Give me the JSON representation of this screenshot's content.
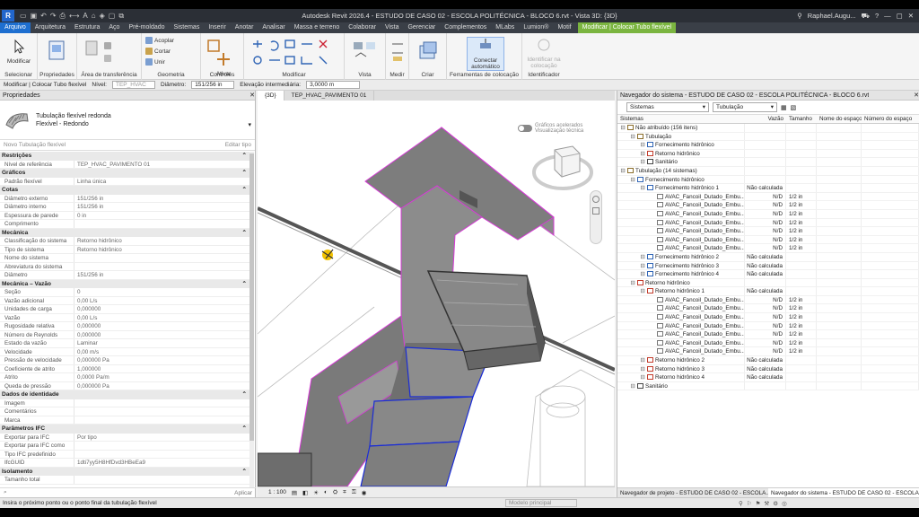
{
  "app": {
    "title": "Autodesk Revit 2026.4 - ESTUDO DE CASO 02 - ESCOLA POLITÉCNICA - BLOCO 6.rvt - Vista 3D: {3D}",
    "user": "Raphael.Augu..."
  },
  "menu": {
    "items": [
      "Arquivo",
      "Arquitetura",
      "Estrutura",
      "Aço",
      "Pré-moldado",
      "Sistemas",
      "Inserir",
      "Anotar",
      "Analisar",
      "Massa e terreno",
      "Colaborar",
      "Vista",
      "Gerenciar",
      "Complementos",
      "MLabs",
      "Lumion®",
      "Motif"
    ],
    "contextual": "Modificar | Colocar Tubo flexível"
  },
  "ribbon": {
    "modify": "Modificar",
    "cut": "Cortar",
    "accept": "Acoplar",
    "join": "Unir",
    "activate": "Ativar",
    "connect": "Conectar automático",
    "identify": "Identificar na colocação",
    "groups": {
      "select": "Selecionar",
      "properties": "Propriedades",
      "clipboard": "Área de transferência",
      "geometry": "Geometria",
      "controls": "Controles",
      "modify": "Modificar",
      "view": "Vista",
      "measure": "Medir",
      "create": "Criar",
      "tools": "Ferramentas de colocação",
      "identifier": "Identificador"
    }
  },
  "options": {
    "context": "Modificar | Colocar Tubo flexível",
    "level_label": "Nível:",
    "level": "TEP_HVAC",
    "diameter_label": "Diâmetro:",
    "diameter": "151/256 in",
    "elev_label": "Elevação intermediária:",
    "elev": "3,0000 m"
  },
  "properties": {
    "header": "Propriedades",
    "type_name": "Tubulação flexível redonda",
    "type_sub": "Flexível - Redondo",
    "new_type": "Novo Tubulação flexível",
    "edit_type": "Editar tipo",
    "apply": "Aplicar",
    "rows": [
      {
        "s": "Restrições"
      },
      {
        "k": "Nível de referência",
        "v": "TEP_HVAC_PAVIMENTO 01"
      },
      {
        "s": "Gráficos"
      },
      {
        "k": "Padrão flexível",
        "v": "Linha única"
      },
      {
        "s": "Cotas"
      },
      {
        "k": "Diâmetro externo",
        "v": "151/256 in"
      },
      {
        "k": "Diâmetro interno",
        "v": "151/256 in"
      },
      {
        "k": "Espessura de parede",
        "v": "0 in"
      },
      {
        "k": "Comprimento",
        "v": ""
      },
      {
        "s": "Mecânica"
      },
      {
        "k": "Classificação do sistema",
        "v": "Retorno hidrônico"
      },
      {
        "k": "Tipo de sistema",
        "v": "Retorno hidrônico"
      },
      {
        "k": "Nome do sistema",
        "v": ""
      },
      {
        "k": "Abreviatura do sistema",
        "v": ""
      },
      {
        "k": "Diâmetro",
        "v": "151/256 in"
      },
      {
        "s": "Mecânica – Vazão"
      },
      {
        "k": "Seção",
        "v": "0"
      },
      {
        "k": "Vazão adicional",
        "v": "0,00 L/s"
      },
      {
        "k": "Unidades de carga",
        "v": "0,000000"
      },
      {
        "k": "Vazão",
        "v": "0,00 L/s"
      },
      {
        "k": "Rugosidade relativa",
        "v": "0,000000"
      },
      {
        "k": "Número de Reynolds",
        "v": "0,000000"
      },
      {
        "k": "Estado da vazão",
        "v": "Laminar"
      },
      {
        "k": "Velocidade",
        "v": "0,00 m/s"
      },
      {
        "k": "Pressão de velocidade",
        "v": "0,000000 Pa"
      },
      {
        "k": "Coeficiente de atrito",
        "v": "1,000000"
      },
      {
        "k": "Atrito",
        "v": "0,0000 Pa/m"
      },
      {
        "k": "Queda de pressão",
        "v": "0,000000 Pa"
      },
      {
        "s": "Dados de identidade"
      },
      {
        "k": "Imagem",
        "v": ""
      },
      {
        "k": "Comentários",
        "v": ""
      },
      {
        "k": "Marca",
        "v": ""
      },
      {
        "s": "Parâmetros IFC"
      },
      {
        "k": "Exportar para IFC",
        "v": "Por tipo"
      },
      {
        "k": "Exportar para IFC como",
        "v": ""
      },
      {
        "k": "Tipo IFC predefinido",
        "v": ""
      },
      {
        "k": "IfcGUID",
        "v": "1dti7yy5H8HfDvd3HBeEa9"
      },
      {
        "s": "Isolamento"
      },
      {
        "k": "Tamanho total",
        "v": ""
      }
    ]
  },
  "view": {
    "tabs": [
      "{3D}",
      "TEP_HVAC_PAVIMENTO 01"
    ],
    "toggle_label_1": "Gráficos acelerados",
    "toggle_label_2": "Visualização técnica",
    "scale": "1 : 100"
  },
  "navigator": {
    "header": "Navegador do sistema - ESTUDO DE CASO 02 - ESCOLA POLITÉCNICA - BLOCO 6.rvt",
    "filter1": "Sistemas",
    "filter2": "Tubulação",
    "columns": [
      "Sistemas",
      "Vazão",
      "Tamanho",
      "Nome do espaço",
      "Número do espaço"
    ],
    "rows": [
      {
        "t": "Não atribuído (156 itens)",
        "d": 0,
        "v": "",
        "z": ""
      },
      {
        "t": "Tubulação",
        "d": 1,
        "v": "",
        "z": ""
      },
      {
        "t": "Fornecimento hidrônico",
        "d": 2,
        "v": "",
        "z": ""
      },
      {
        "t": "Retorno hidrônico",
        "d": 2,
        "v": "",
        "z": ""
      },
      {
        "t": "Sanitário",
        "d": 2,
        "v": "",
        "z": ""
      },
      {
        "t": "Tubulação (14 sistemas)",
        "d": 0,
        "v": "",
        "z": ""
      },
      {
        "t": "Fornecimento hidrônico",
        "d": 1,
        "v": "",
        "z": ""
      },
      {
        "t": "Fornecimento hidrônico 1",
        "d": 2,
        "v": "Não calculada",
        "z": ""
      },
      {
        "t": "AVAC_Fancoil_Dutado_Embu...",
        "d": 3,
        "v": "N/D",
        "z": "1/2 in"
      },
      {
        "t": "AVAC_Fancoil_Dutado_Embu...",
        "d": 3,
        "v": "N/D",
        "z": "1/2 in"
      },
      {
        "t": "AVAC_Fancoil_Dutado_Embu...",
        "d": 3,
        "v": "N/D",
        "z": "1/2 in"
      },
      {
        "t": "AVAC_Fancoil_Dutado_Embu...",
        "d": 3,
        "v": "N/D",
        "z": "1/2 in"
      },
      {
        "t": "AVAC_Fancoil_Dutado_Embu...",
        "d": 3,
        "v": "N/D",
        "z": "1/2 in"
      },
      {
        "t": "AVAC_Fancoil_Dutado_Embu...",
        "d": 3,
        "v": "N/D",
        "z": "1/2 in"
      },
      {
        "t": "AVAC_Fancoil_Dutado_Embu...",
        "d": 3,
        "v": "N/D",
        "z": "1/2 in"
      },
      {
        "t": "Fornecimento hidrônico 2",
        "d": 2,
        "v": "Não calculada",
        "z": ""
      },
      {
        "t": "Fornecimento hidrônico 3",
        "d": 2,
        "v": "Não calculada",
        "z": ""
      },
      {
        "t": "Fornecimento hidrônico 4",
        "d": 2,
        "v": "Não calculada",
        "z": ""
      },
      {
        "t": "Retorno hidrônico",
        "d": 1,
        "v": "",
        "z": ""
      },
      {
        "t": "Retorno hidrônico 1",
        "d": 2,
        "v": "Não calculada",
        "z": ""
      },
      {
        "t": "AVAC_Fancoil_Dutado_Embu...",
        "d": 3,
        "v": "N/D",
        "z": "1/2 in"
      },
      {
        "t": "AVAC_Fancoil_Dutado_Embu...",
        "d": 3,
        "v": "N/D",
        "z": "1/2 in"
      },
      {
        "t": "AVAC_Fancoil_Dutado_Embu...",
        "d": 3,
        "v": "N/D",
        "z": "1/2 in"
      },
      {
        "t": "AVAC_Fancoil_Dutado_Embu...",
        "d": 3,
        "v": "N/D",
        "z": "1/2 in"
      },
      {
        "t": "AVAC_Fancoil_Dutado_Embu...",
        "d": 3,
        "v": "N/D",
        "z": "1/2 in"
      },
      {
        "t": "AVAC_Fancoil_Dutado_Embu...",
        "d": 3,
        "v": "N/D",
        "z": "1/2 in"
      },
      {
        "t": "AVAC_Fancoil_Dutado_Embu...",
        "d": 3,
        "v": "N/D",
        "z": "1/2 in"
      },
      {
        "t": "Retorno hidrônico 2",
        "d": 2,
        "v": "Não calculada",
        "z": ""
      },
      {
        "t": "Retorno hidrônico 3",
        "d": 2,
        "v": "Não calculada",
        "z": ""
      },
      {
        "t": "Retorno hidrônico 4",
        "d": 2,
        "v": "Não calculada",
        "z": ""
      },
      {
        "t": "Sanitário",
        "d": 1,
        "v": "",
        "z": ""
      }
    ],
    "bottom_tabs": [
      "Navegador de projeto - ESTUDO DE CASO 02 - ESCOLA...",
      "Navegador do sistema - ESTUDO DE CASO 02 - ESCOLA..."
    ]
  },
  "status": {
    "message": "Insira o próximo ponto ou o ponto final da tubulação flexível",
    "model": "Modelo principal"
  },
  "colors": {
    "accent": "#1e6fd0",
    "contextual": "#7bb540",
    "duct_outline": "#d63ad6",
    "blue_outline": "#1a2cd6"
  }
}
